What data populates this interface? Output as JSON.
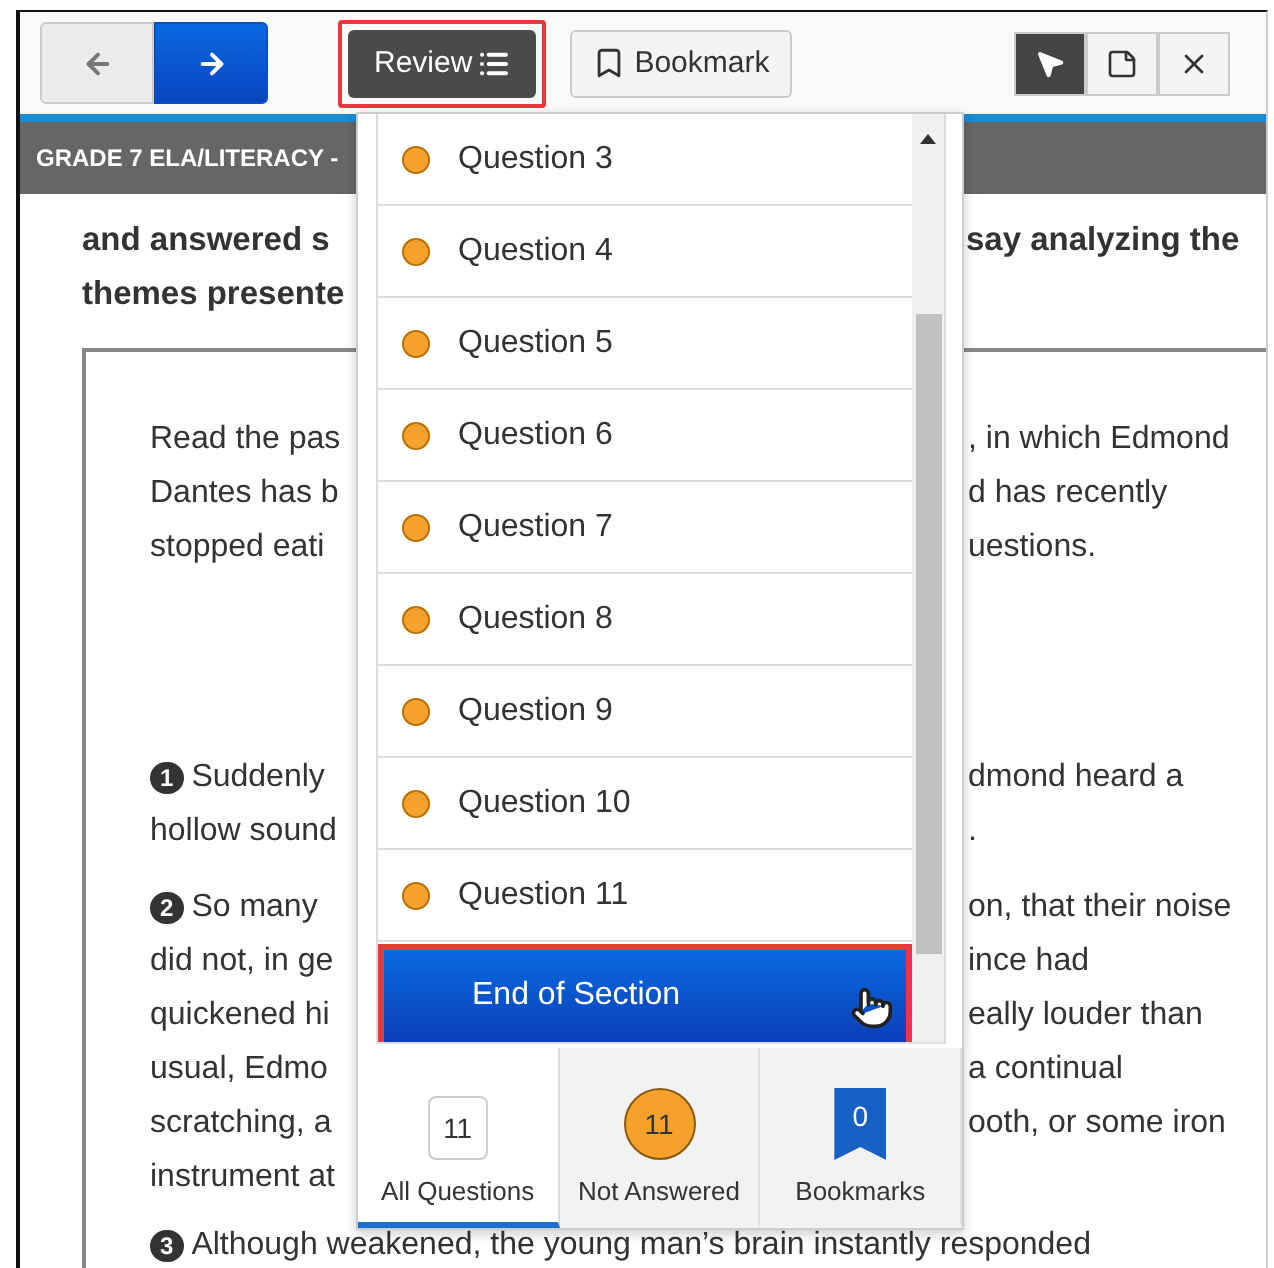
{
  "toolbar": {
    "nav": [
      {
        "kind": "back",
        "disabled": true
      },
      {
        "kind": "forward",
        "disabled": false
      }
    ],
    "review": {
      "label": "Review",
      "highlighted": true
    },
    "bookmark": {
      "label": "Bookmark"
    },
    "tools": [
      {
        "kind": "pointer",
        "selected": true
      },
      {
        "kind": "note",
        "selected": false
      },
      {
        "kind": "close",
        "selected": false
      }
    ]
  },
  "header": {
    "title": "GRADE 7 ELA/LITERACY -"
  },
  "prompt": [
    {
      "left": "and answered s",
      "right": "say analyzing the"
    },
    {
      "left": "themes presente"
    }
  ],
  "passage": {
    "intro": [
      {
        "left": "Read the pas",
        "right": ", in which Edmond"
      },
      {
        "left": "Dantes has b",
        "right": "d has recently"
      },
      {
        "left": "stopped eati",
        "right": "uestions."
      }
    ],
    "paragraphs": [
      {
        "number": "1",
        "lines": [
          {
            "left": "Suddenly",
            "right": "dmond heard a"
          },
          {
            "left": "hollow sound",
            "right": "."
          }
        ]
      },
      {
        "number": "2",
        "lines": [
          {
            "left": "So many",
            "right": "on, that their noise"
          },
          {
            "left": "did not, in ge",
            "right": "ince had"
          },
          {
            "left": "quickened hi",
            "right": "eally louder than"
          },
          {
            "left": "usual, Edmo",
            "right": "a continual"
          },
          {
            "left": "scratching, a",
            "right": "ooth, or some iron"
          },
          {
            "left": "instrument at"
          }
        ]
      },
      {
        "number": "3",
        "lines": [
          {
            "left": "Although weakened, the young man’s brain instantly responded"
          }
        ]
      }
    ]
  },
  "review_menu": {
    "questions": [
      {
        "label": "Question 3",
        "color": "#f5a12b"
      },
      {
        "label": "Question 4",
        "color": "#f5a12b"
      },
      {
        "label": "Question 5",
        "color": "#f5a12b"
      },
      {
        "label": "Question 6",
        "color": "#f5a12b"
      },
      {
        "label": "Question 7",
        "color": "#f5a12b"
      },
      {
        "label": "Question 8",
        "color": "#f5a12b"
      },
      {
        "label": "Question 9",
        "color": "#f5a12b"
      },
      {
        "label": "Question 10",
        "color": "#f5a12b"
      },
      {
        "label": "Question 11",
        "color": "#f5a12b"
      }
    ],
    "end": {
      "label": "End of Section",
      "highlighted": true
    },
    "tabs": [
      {
        "kind": "all",
        "count": "11",
        "label": "All Questions",
        "selected": true
      },
      {
        "kind": "unanswered",
        "count": "11",
        "label": "Not Answered",
        "selected": false
      },
      {
        "kind": "bookmarks",
        "count": "0",
        "label": "Bookmarks",
        "selected": false
      }
    ]
  }
}
